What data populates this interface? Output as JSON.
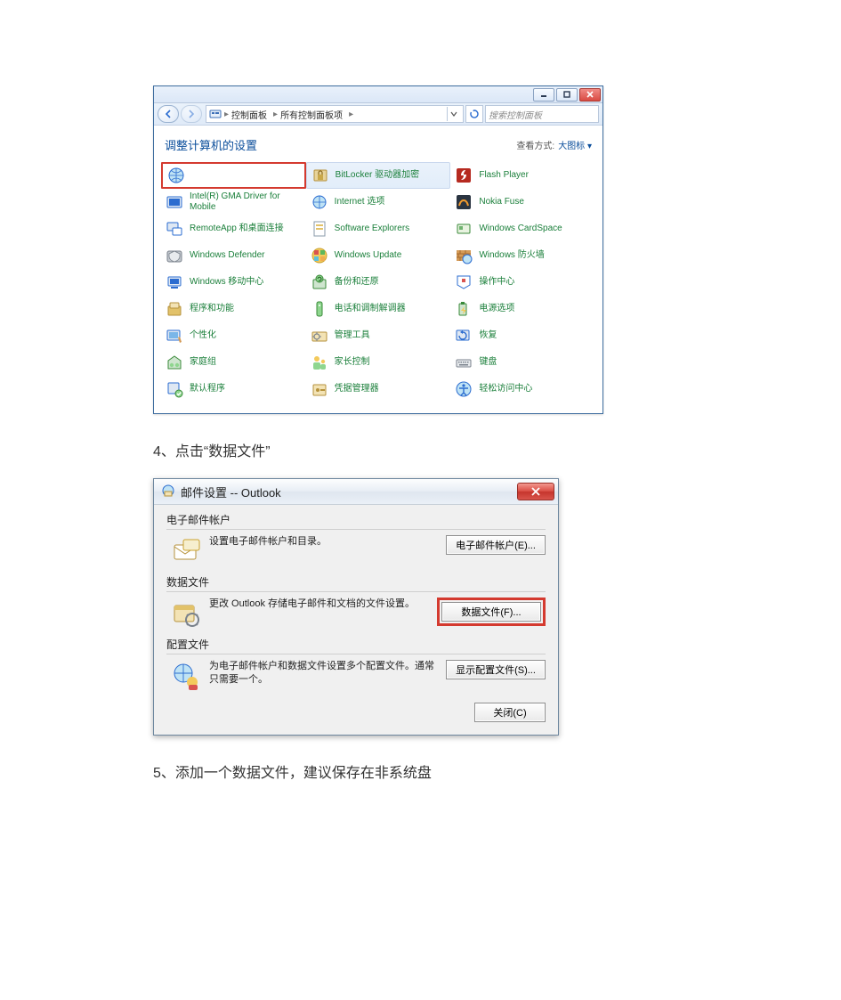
{
  "cp": {
    "breadcrumb": {
      "seg1": "控制面板",
      "seg2": "所有控制面板项",
      "sep": "▸"
    },
    "search_placeholder": "搜索控制面板",
    "header_title": "调整计算机的设置",
    "view_label": "查看方式:",
    "view_value": "大图标 ▾",
    "labels": {
      "bitlocker": "BitLocker 驱动器加密",
      "flash": "Flash Player",
      "gma": "Intel(R) GMA Driver for Mobile",
      "internet": "Internet 选项",
      "nokia": "Nokia Fuse",
      "remoteapp": "RemoteApp 和桌面连接",
      "softexp": "Software Explorers",
      "cardspace": "Windows CardSpace",
      "defender": "Windows Defender",
      "winupdate": "Windows Update",
      "firewall": "Windows 防火墙",
      "mobility": "Windows 移动中心",
      "backup": "备份和还原",
      "action": "操作中心",
      "programs": "程序和功能",
      "modem": "电话和调制解调器",
      "power": "电源选项",
      "personal": "个性化",
      "admintools": "管理工具",
      "recovery": "恢复",
      "homegroup": "家庭组",
      "parental": "家长控制",
      "keyboard": "键盘",
      "defaultprog": "默认程序",
      "credmgr": "凭据管理器",
      "ease": "轻松访问中心"
    }
  },
  "step4": "4、点击“数据文件”",
  "mail": {
    "title": "邮件设置 -- Outlook",
    "g1_title": "电子邮件帐户",
    "g1_text": "设置电子邮件帐户和目录。",
    "g1_btn": "电子邮件帐户(E)...",
    "g2_title": "数据文件",
    "g2_text": "更改 Outlook 存储电子邮件和文档的文件设置。",
    "g2_btn": "数据文件(F)...",
    "g3_title": "配置文件",
    "g3_text": "为电子邮件帐户和数据文件设置多个配置文件。通常只需要一个。",
    "g3_btn": "显示配置文件(S)...",
    "close_btn": "关闭(C)"
  },
  "step5": "5、添加一个数据文件，建议保存在非系统盘"
}
